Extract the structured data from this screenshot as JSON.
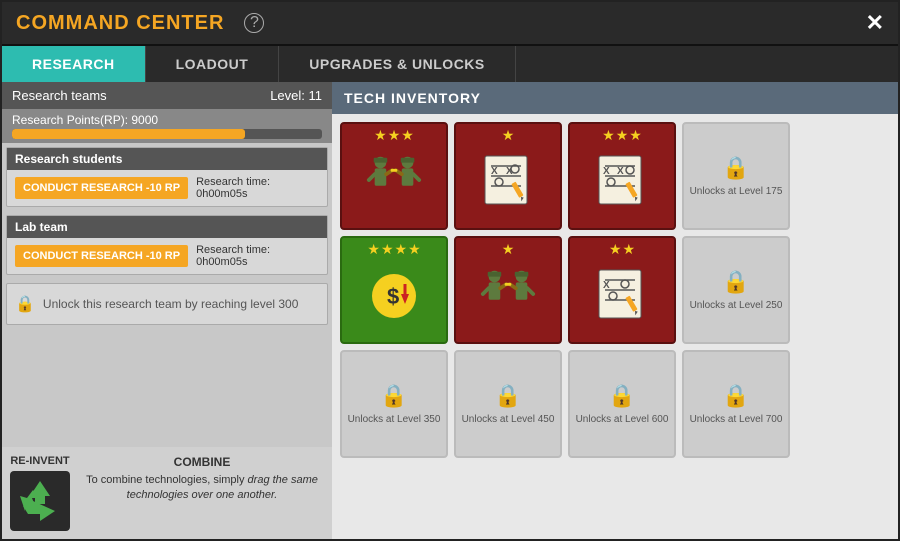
{
  "modal": {
    "title": "COMMAND CENTER",
    "close_label": "✕",
    "help_label": "?"
  },
  "tabs": [
    {
      "label": "RESEARCH",
      "active": true
    },
    {
      "label": "LOADOUT",
      "active": false
    },
    {
      "label": "UPGRADES & UNLOCKS",
      "active": false
    }
  ],
  "left": {
    "teams_label": "Research teams",
    "level_label": "Level: 11",
    "rp_label": "Research Points(RP): 9000",
    "rp_percent": 75,
    "students": {
      "label": "Research students",
      "btn_label": "CONDUCT RESEARCH -10 RP",
      "time_label": "Research time:",
      "time_value": "0h00m05s"
    },
    "lab": {
      "label": "Lab team",
      "btn_label": "CONDUCT RESEARCH -10 RP",
      "time_label": "Research time:",
      "time_value": "0h00m05s"
    },
    "locked_team": {
      "label": "Unlock this research team by reaching level 300"
    },
    "reinvent": {
      "label": "RE-INVENT"
    },
    "combine": {
      "label": "COMBINE",
      "text": "To combine technologies, simply drag the same technologies over one another."
    }
  },
  "right": {
    "header": "TECH INVENTORY",
    "cards": [
      {
        "type": "active-red",
        "stars": 3,
        "icon": "soldiers-high-five"
      },
      {
        "type": "active-red",
        "stars": 1,
        "icon": "tactic-board"
      },
      {
        "type": "active-red",
        "stars": 3,
        "icon": "tactic-board-2"
      },
      {
        "type": "locked",
        "unlock_level": "175"
      },
      {
        "type": "active-green",
        "stars": 4,
        "icon": "dollar-down"
      },
      {
        "type": "active-red",
        "stars": 1,
        "icon": "soldiers-high-five-2"
      },
      {
        "type": "active-red",
        "stars": 2,
        "icon": "tactic-board-3"
      },
      {
        "type": "locked",
        "unlock_level": "250"
      },
      {
        "type": "locked",
        "unlock_level": "350"
      },
      {
        "type": "locked",
        "unlock_level": "450"
      },
      {
        "type": "locked",
        "unlock_level": "600"
      },
      {
        "type": "locked",
        "unlock_level": "700"
      }
    ]
  }
}
